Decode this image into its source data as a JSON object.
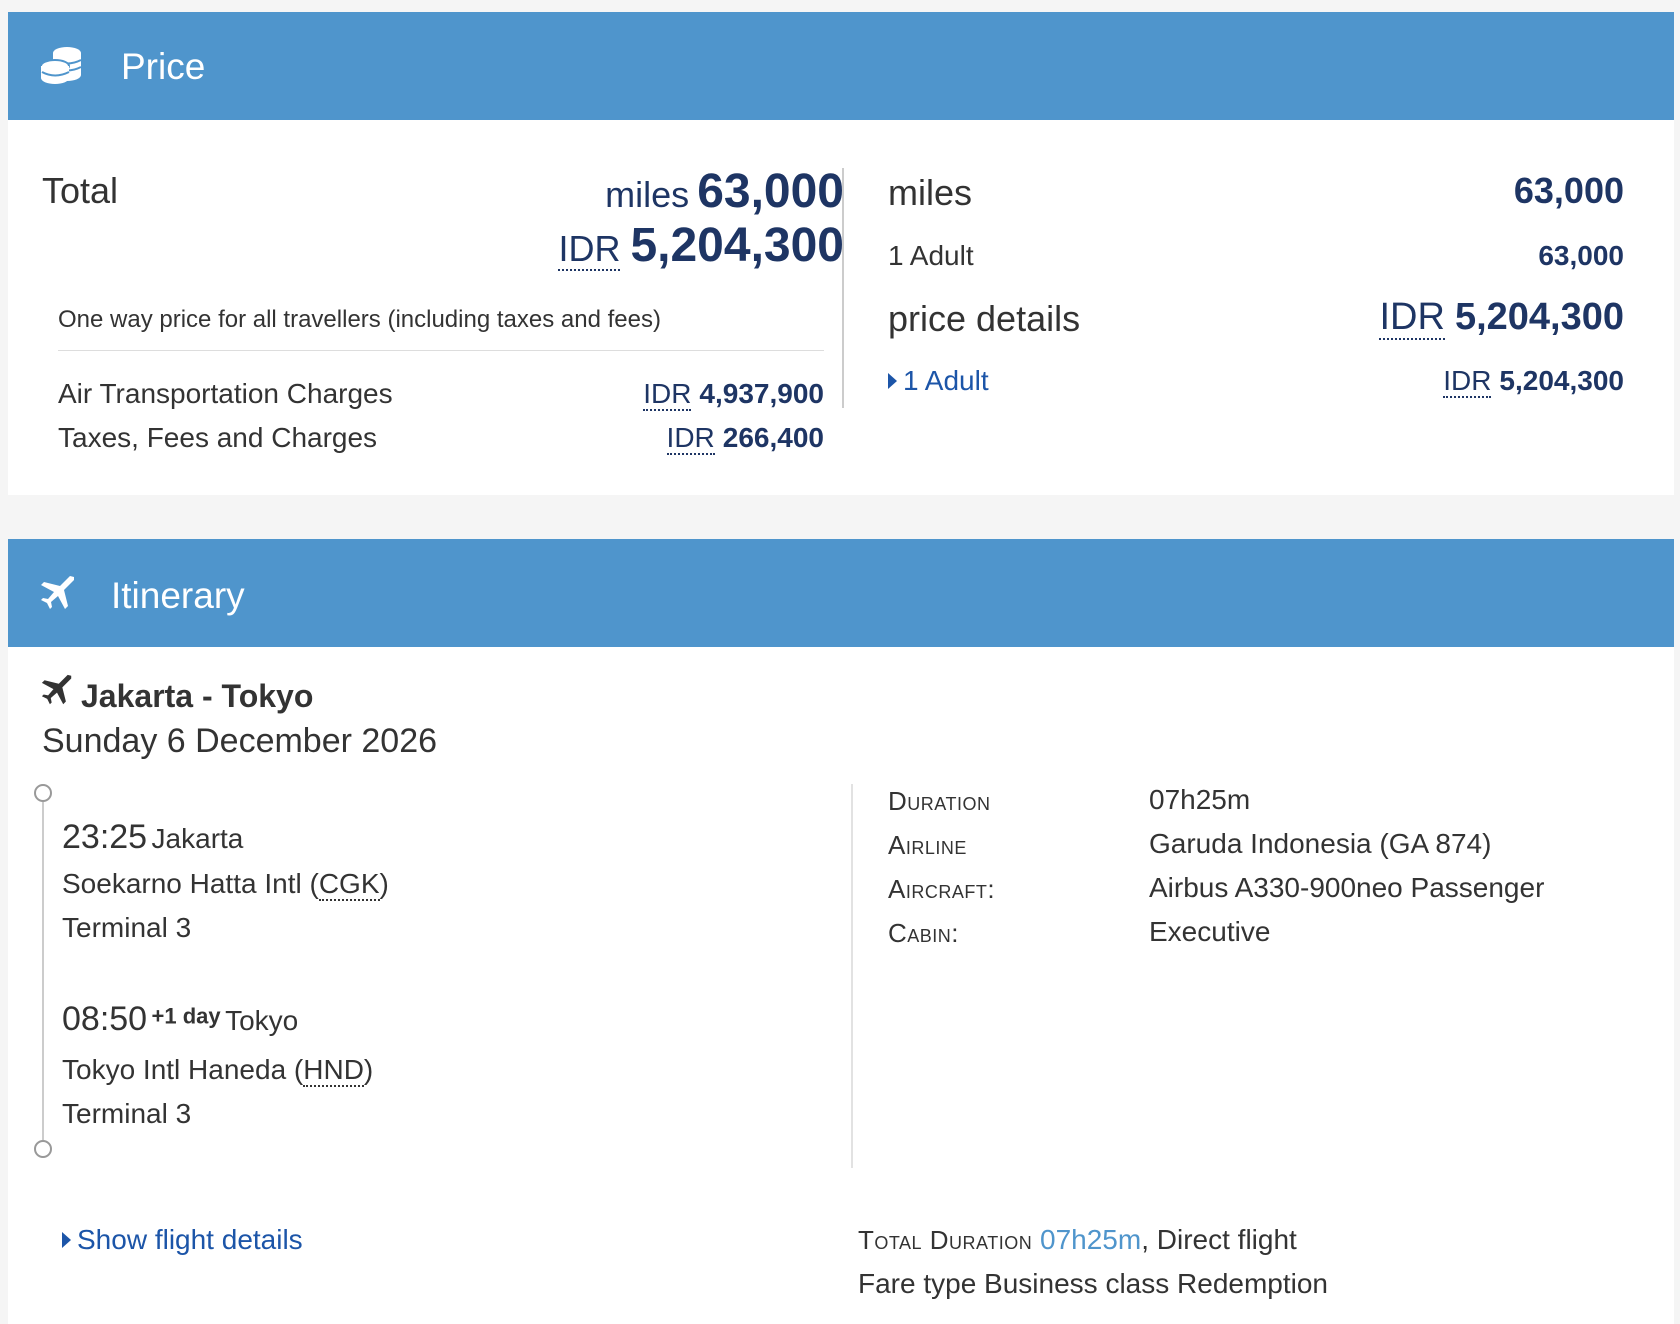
{
  "price": {
    "title": "Price",
    "total_label": "Total",
    "total_miles_unit": "miles",
    "total_miles": "63,000",
    "total_idr_unit": "IDR",
    "total_idr": "5,204,300",
    "note": "One way price for all travellers (including taxes and fees)",
    "charges": [
      {
        "label": "Air Transportation Charges",
        "currency": "IDR",
        "amount": "4,937,900"
      },
      {
        "label": "Taxes, Fees and Charges",
        "currency": "IDR",
        "amount": "266,400"
      }
    ],
    "right": {
      "miles_label": "miles",
      "miles_value": "63,000",
      "adult_label": "1 Adult",
      "adult_miles": "63,000",
      "details_label": "price details",
      "details_currency": "IDR",
      "details_value": "5,204,300",
      "details_adult_label": "1 Adult",
      "details_adult_currency": "IDR",
      "details_adult_value": "5,204,300"
    }
  },
  "itinerary": {
    "title": "Itinerary",
    "route": "Jakarta - Tokyo",
    "date": "Sunday 6 December 2026",
    "departure": {
      "time": "23:25",
      "city": "Jakarta",
      "airport": "Soekarno Hatta Intl",
      "code": "CGK",
      "terminal": "Terminal 3"
    },
    "arrival": {
      "time": "08:50",
      "day_offset": "+1 day",
      "city": "Tokyo",
      "airport": "Tokyo Intl Haneda",
      "code": "HND",
      "terminal": "Terminal 3"
    },
    "details": [
      {
        "label": "Duration",
        "value": "07h25m"
      },
      {
        "label": "Airline",
        "value": "Garuda Indonesia (GA 874)"
      },
      {
        "label": "Aircraft:",
        "value": "Airbus A330-900neo Passenger"
      },
      {
        "label": "Cabin:",
        "value": "Executive"
      }
    ],
    "show_details": "Show flight details",
    "total_duration_label": "Total Duration",
    "total_duration_value": "07h25m",
    "direct": ", Direct flight",
    "fare_type": "Fare type Business class Redemption"
  },
  "colors": {
    "header": "#4f95cc",
    "navy": "#1e3564",
    "link": "#1c55a8"
  },
  "icons": [
    "coins-icon",
    "plane-icon"
  ]
}
